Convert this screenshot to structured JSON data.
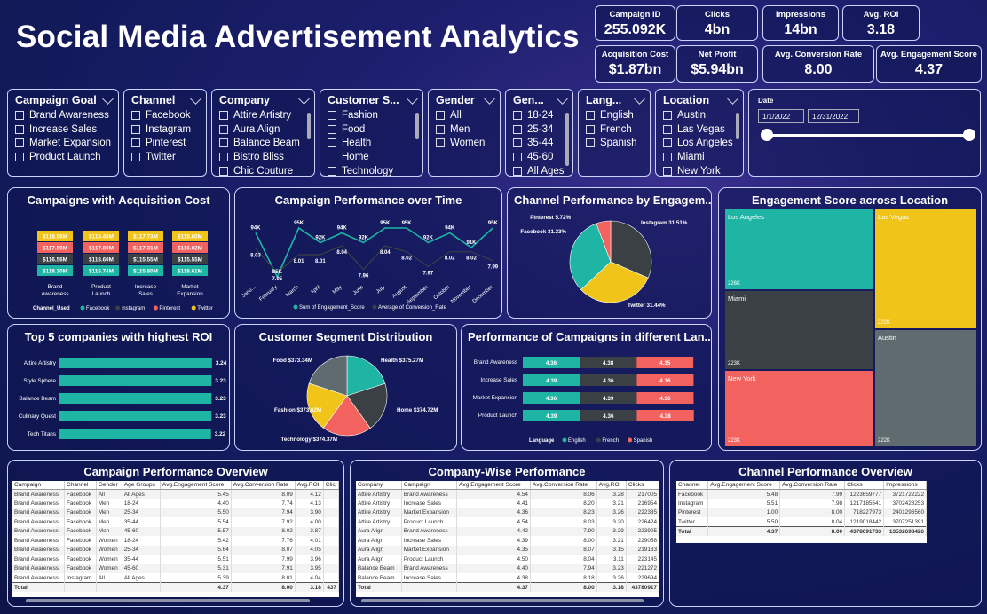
{
  "title": "Social Media Advertisement Analytics",
  "kpis": [
    {
      "label": "Campaign ID",
      "value": "255.092K"
    },
    {
      "label": "Clicks",
      "value": "4bn"
    },
    {
      "label": "Impressions",
      "value": "14bn"
    },
    {
      "label": "Avg. ROI",
      "value": "3.18"
    },
    {
      "label": "Acquisition Cost",
      "value": "$1.87bn"
    },
    {
      "label": "Net Profit",
      "value": "$5.94bn"
    },
    {
      "label": "Avg. Conversion Rate",
      "value": "8.00"
    },
    {
      "label": "Avg. Engagement Score",
      "value": "4.37"
    }
  ],
  "slicers": [
    {
      "title": "Campaign Goal",
      "items": [
        "Brand Awareness",
        "Increase Sales",
        "Market Expansion",
        "Product Launch"
      ]
    },
    {
      "title": "Channel",
      "items": [
        "Facebook",
        "Instagram",
        "Pinterest",
        "Twitter"
      ]
    },
    {
      "title": "Company",
      "items": [
        "Attire Artistry",
        "Aura Align",
        "Balance Beam",
        "Bistro Bliss",
        "Chic Couture"
      ]
    },
    {
      "title": "Customer S...",
      "items": [
        "Fashion",
        "Food",
        "Health",
        "Home",
        "Technology"
      ]
    },
    {
      "title": "Gender",
      "items": [
        "All",
        "Men",
        "Women"
      ]
    },
    {
      "title": "Gen...",
      "items": [
        "18-24",
        "25-34",
        "35-44",
        "45-60",
        "All Ages"
      ]
    },
    {
      "title": "Lang...",
      "items": [
        "English",
        "French",
        "Spanish"
      ]
    },
    {
      "title": "Location",
      "items": [
        "Austin",
        "Las Vegas",
        "Los Angeles",
        "Miami",
        "New York"
      ]
    }
  ],
  "date": {
    "label": "Date",
    "start": "1/1/2022",
    "end": "12/31/2022"
  },
  "colors": {
    "teal": "#1fb5a4",
    "dark": "#3a4044",
    "red": "#f2625f",
    "yellow": "#f0c419",
    "grey": "#5f6b6e"
  },
  "acq": {
    "title": "Campaigns with Acquisition Cost",
    "legend_title": "Channel_Used",
    "legend": [
      "Facebook",
      "Instagram",
      "Pinterest",
      "Twitter"
    ],
    "chart_data": {
      "type": "bar",
      "categories": [
        "Brand Awareness",
        "Product Launch",
        "Increase Sales",
        "Market Expansion"
      ],
      "series": [
        {
          "name": "Facebook",
          "labels": [
            "$118.30M",
            "$115.74M",
            "$115.80M",
            "$118.61M"
          ]
        },
        {
          "name": "Instagram",
          "labels": [
            "$116.56M",
            "$118.60M",
            "$115.55M",
            "$115.55M"
          ]
        },
        {
          "name": "Pinterest",
          "labels": [
            "$117.59M",
            "$117.80M",
            "$117.31M",
            "$116.02M"
          ]
        },
        {
          "name": "Twitter",
          "labels": [
            "$118.56M",
            "$115.46M",
            "$117.73M",
            "$115.60M"
          ]
        }
      ]
    }
  },
  "perf": {
    "title": "Campaign Performance over Time",
    "legend": [
      "Sum of Engagement_Score",
      "Average of Conversion_Rate"
    ],
    "chart_data": {
      "type": "line",
      "categories": [
        "Janu...",
        "February",
        "March",
        "April",
        "May",
        "June",
        "July",
        "August",
        "September",
        "October",
        "November",
        "December"
      ],
      "series": [
        {
          "name": "Sum of Engagement_Score",
          "labels": [
            "94K",
            "85K",
            "95K",
            "92K",
            "94K",
            "92K",
            "95K",
            "95K",
            "92K",
            "94K",
            "91K",
            "95K"
          ],
          "values": [
            94,
            85,
            95,
            92,
            94,
            92,
            95,
            95,
            92,
            94,
            91,
            95
          ]
        },
        {
          "name": "Average of Conversion_Rate",
          "labels": [
            "8.03",
            "7.95",
            "8.01",
            "8.01",
            "8.04",
            "7.96",
            "8.04",
            "8.02",
            "7.97",
            "8.02",
            "8.02",
            "7.99"
          ],
          "values": [
            8.03,
            7.95,
            8.01,
            8.01,
            8.04,
            7.96,
            8.04,
            8.02,
            7.97,
            8.02,
            8.02,
            7.99
          ]
        }
      ]
    }
  },
  "channel": {
    "title": "Channel Performance by Engagem...",
    "chart_data": {
      "type": "pie",
      "labels": [
        "Instagram",
        "Twitter",
        "Facebook",
        "Pinterest"
      ],
      "values": [
        31.51,
        31.44,
        31.33,
        5.72
      ],
      "text": [
        "Instagram 31.51%",
        "Twitter 31.44%",
        "Facebook 31.33%",
        "Pinterest 5.72%"
      ]
    }
  },
  "treemap": {
    "title": "Engagement Score across Location",
    "cells": [
      {
        "name": "Los Angeles",
        "value": "226K"
      },
      {
        "name": "Las Vegas",
        "value": "222K"
      },
      {
        "name": "Miami",
        "value": "223K"
      },
      {
        "name": "Austin",
        "value": "222K"
      },
      {
        "name": "New York",
        "value": "223K"
      }
    ]
  },
  "roi": {
    "title": "Top 5 companies with highest ROI",
    "chart_data": {
      "type": "bar",
      "categories": [
        "Attire Artistry",
        "Style Sphere",
        "Balance Beam",
        "Culinary Quest",
        "Tech Titans"
      ],
      "values": [
        3.24,
        3.23,
        3.23,
        3.23,
        3.22
      ],
      "labels": [
        "3.24",
        "3.23",
        "3.23",
        "3.23",
        "3.22"
      ]
    }
  },
  "segment": {
    "title": "Customer Segment Distribution",
    "chart_data": {
      "type": "pie",
      "labels": [
        "Health",
        "Home",
        "Technology",
        "Fashion",
        "Food"
      ],
      "values": [
        375.27,
        374.72,
        374.37,
        373.62,
        373.34
      ],
      "text": [
        "Health $375.27M",
        "Home $374.72M",
        "Technology $374.37M",
        "Fashion $373.62M",
        "Food $373.34M"
      ]
    }
  },
  "lang": {
    "title": "Performance of Campaigns in different Lan...",
    "legend_title": "Language",
    "legend": [
      "English",
      "French",
      "Spanish"
    ],
    "chart_data": {
      "type": "bar",
      "categories": [
        "Brand Awareness",
        "Increase Sales",
        "Market Expansion",
        "Product Launch"
      ],
      "series": [
        {
          "name": "English",
          "values": [
            4.36,
            4.39,
            4.36,
            4.39
          ]
        },
        {
          "name": "French",
          "values": [
            4.38,
            4.36,
            4.39,
            4.36
          ]
        },
        {
          "name": "Spanish",
          "values": [
            4.35,
            4.36,
            4.36,
            4.38
          ]
        }
      ]
    }
  },
  "t1": {
    "title": "Campaign Performance Overview",
    "headers": [
      "Campaign",
      "Channel",
      "Gender",
      "Age Groups",
      "Avg.Engagement Score",
      "Avg.Conversion Rate",
      "Avg.ROI",
      "Clic"
    ],
    "rows": [
      [
        "Brand Awareness",
        "Facebook",
        "All",
        "All Ages",
        "5.45",
        "8.09",
        "4.12",
        "",
        ""
      ],
      [
        "Brand Awareness",
        "Facebook",
        "Men",
        "18-24",
        "4.40",
        "7.74",
        "4.13",
        ""
      ],
      [
        "Brand Awareness",
        "Facebook",
        "Men",
        "25-34",
        "5.50",
        "7.94",
        "3.90",
        ""
      ],
      [
        "Brand Awareness",
        "Facebook",
        "Men",
        "35-44",
        "5.54",
        "7.92",
        "4.00",
        ""
      ],
      [
        "Brand Awareness",
        "Facebook",
        "Men",
        "45-60",
        "5.57",
        "8.02",
        "3.87",
        ""
      ],
      [
        "Brand Awareness",
        "Facebook",
        "Women",
        "18-24",
        "5.42",
        "7.76",
        "4.01",
        ""
      ],
      [
        "Brand Awareness",
        "Facebook",
        "Women",
        "25-34",
        "5.64",
        "8.07",
        "4.05",
        ""
      ],
      [
        "Brand Awareness",
        "Facebook",
        "Women",
        "35-44",
        "5.51",
        "7.99",
        "3.96",
        ""
      ],
      [
        "Brand Awareness",
        "Facebook",
        "Women",
        "45-60",
        "5.31",
        "7.91",
        "3.95",
        ""
      ],
      [
        "Brand Awareness",
        "Instagram",
        "All",
        "All Ages",
        "5.39",
        "8.01",
        "4.04",
        ""
      ]
    ],
    "total": [
      "Total",
      "",
      "",
      "",
      "4.37",
      "8.00",
      "3.18",
      "437"
    ]
  },
  "t2": {
    "title": "Company-Wise Performance",
    "headers": [
      "Company",
      "Campaign",
      "Avg.Engagement Score",
      "Avg.Conversion Rate",
      "Avg.ROI",
      "Clicks"
    ],
    "rows": [
      [
        "Attire Artistry",
        "Brand Awareness",
        "4.54",
        "8.06",
        "3.28",
        "217005"
      ],
      [
        "Attire Artistry",
        "Increase Sales",
        "4.41",
        "8.20",
        "3.21",
        "216954"
      ],
      [
        "Attire Artistry",
        "Market Expansion",
        "4.36",
        "8.23",
        "3.26",
        "222335"
      ],
      [
        "Attire Artistry",
        "Product Launch",
        "4.54",
        "8.03",
        "3.20",
        "226424"
      ],
      [
        "Aura Align",
        "Brand Awareness",
        "4.42",
        "7.90",
        "3.29",
        "223905"
      ],
      [
        "Aura Align",
        "Increase Sales",
        "4.39",
        "8.00",
        "3.21",
        "229058"
      ],
      [
        "Aura Align",
        "Market Expansion",
        "4.35",
        "8.07",
        "3.15",
        "219183"
      ],
      [
        "Aura Align",
        "Product Launch",
        "4.50",
        "8.04",
        "3.11",
        "223145"
      ],
      [
        "Balance Beam",
        "Brand Awareness",
        "4.40",
        "7.94",
        "3.23",
        "221272"
      ],
      [
        "Balance Beam",
        "Increase Sales",
        "4.38",
        "8.18",
        "3.26",
        "229694"
      ]
    ],
    "total": [
      "Total",
      "",
      "4.37",
      "8.00",
      "3.18",
      "43780917"
    ]
  },
  "t3": {
    "title": "Channel Performance Overview",
    "headers": [
      "Channel",
      "Avg.Engagement Score",
      "Avg.Conversion Rate",
      "Clicks",
      "Impressions"
    ],
    "rows": [
      [
        "Facebook",
        "5.48",
        "7.99",
        "1223659777",
        "3721722222"
      ],
      [
        "Instagram",
        "5.51",
        "7.98",
        "1217185541",
        "3702428253"
      ],
      [
        "Pinterest",
        "1.00",
        "8.00",
        "718227973",
        "2401296560"
      ],
      [
        "Twitter",
        "5.50",
        "8.04",
        "1219018442",
        "3707251391"
      ]
    ],
    "total": [
      "Total",
      "4.37",
      "8.00",
      "4378091733",
      "13532698426"
    ]
  }
}
